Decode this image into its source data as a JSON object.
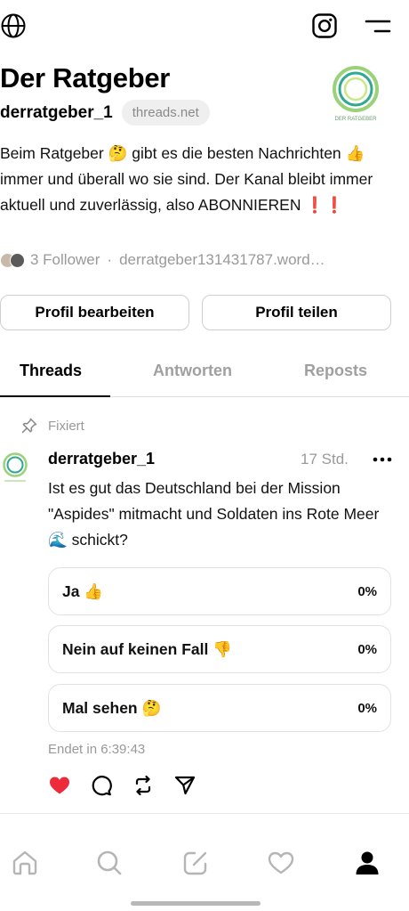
{
  "topbar": {
    "left_icon": "globe-icon",
    "right_icons": [
      "instagram-icon",
      "menu-icon"
    ]
  },
  "profile": {
    "name": "Der Ratgeber",
    "handle": "derratgeber_1",
    "domain_badge": "threads.net",
    "avatar_caption": "DER RATGEBER",
    "bio": "Beim Ratgeber 🤔 gibt es die besten Nachrichten 👍 immer und überall wo sie sind. Der Kanal bleibt immer aktuell und zuverlässig, also ABONNIEREN ❗❗",
    "followers": "3 Follower",
    "separator": "·",
    "link": "derratgeber131431787.word…"
  },
  "buttons": {
    "edit": "Profil bearbeiten",
    "share": "Profil teilen"
  },
  "tabs": {
    "threads": "Threads",
    "answers": "Antworten",
    "reposts": "Reposts",
    "active": "threads"
  },
  "post": {
    "pinned_label": "Fixiert",
    "user": "derratgeber_1",
    "time": "17 Std.",
    "text": "Ist es gut das Deutschland bei der Mission \"Aspides\" mitmacht und Soldaten ins Rote Meer 🌊 schickt?",
    "poll": {
      "options": [
        {
          "label": "Ja 👍",
          "percent": "0%"
        },
        {
          "label": "Nein auf keinen Fall 👎",
          "percent": "0%"
        },
        {
          "label": "Mal sehen 🤔",
          "percent": "0%"
        }
      ],
      "ends": "Endet in 6:39:43"
    },
    "liked": true
  },
  "bottom_nav": {
    "items": [
      "home-icon",
      "search-icon",
      "compose-icon",
      "heart-icon",
      "profile-icon"
    ],
    "active": "profile-icon"
  },
  "colors": {
    "like": "#ee2b3b",
    "muted": "#999999",
    "logo_green": "#9ad27a",
    "logo_teal": "#2fa98f"
  }
}
